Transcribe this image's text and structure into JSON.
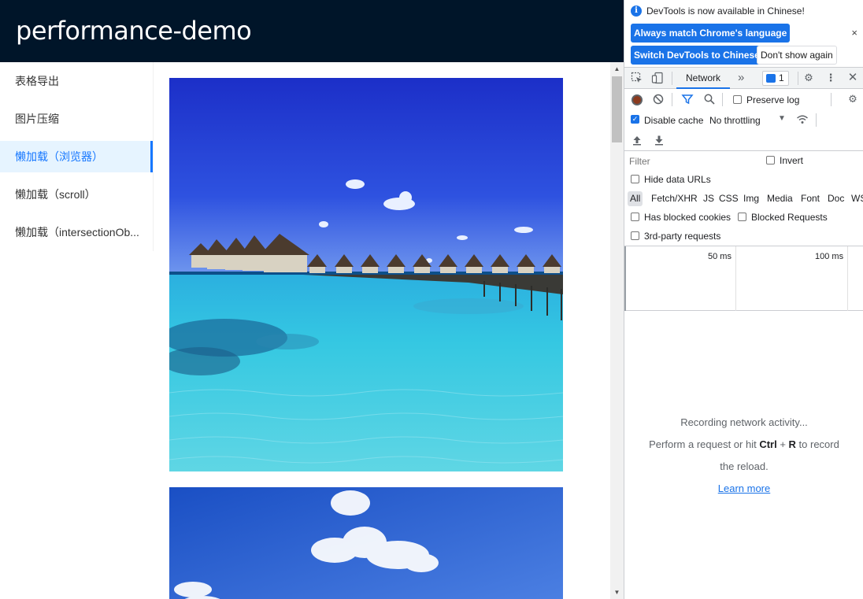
{
  "app": {
    "title": "performance-demo",
    "menu": [
      {
        "label": "表格导出"
      },
      {
        "label": "图片压缩"
      },
      {
        "label": "懒加载（浏览器）",
        "active": true
      },
      {
        "label": "懒加载（scroll）"
      },
      {
        "label": "懒加载（intersectionOb..."
      }
    ],
    "images": [
      {
        "icon": "overwater-villas-image"
      },
      {
        "icon": "sky-clouds-image"
      }
    ]
  },
  "devtools": {
    "infobar": {
      "message": "DevTools is now available in Chinese!",
      "match_language": "Always match Chrome's language",
      "switch_chinese": "Switch DevTools to Chinese",
      "dont_show": "Don't show again",
      "close": "×"
    },
    "tabs": {
      "network": "Network",
      "more": "»",
      "issues_count": "1"
    },
    "toolbar": {
      "preserve_log": "Preserve log",
      "disable_cache": "Disable cache",
      "throttling": "No throttling"
    },
    "filter": {
      "placeholder": "Filter",
      "invert": "Invert",
      "hide_data_urls": "Hide data URLs",
      "types": [
        "All",
        "Fetch/XHR",
        "JS",
        "CSS",
        "Img",
        "Media",
        "Font",
        "Doc",
        "WS"
      ],
      "has_blocked_cookies": "Has blocked cookies",
      "blocked_requests": "Blocked Requests",
      "third_party": "3rd-party requests"
    },
    "timeline": {
      "t1": "50 ms",
      "t2": "100 ms"
    },
    "empty": {
      "line1": "Recording network activity...",
      "line2_a": "Perform a request or hit ",
      "ctrl": "Ctrl",
      "plus": " + ",
      "r": "R",
      "line2_b": " to record",
      "line3": "the reload.",
      "learn_more": "Learn more"
    },
    "colors": {
      "accent": "#1a73e8",
      "header_bg": "#001529",
      "menu_active": "#1677ff"
    }
  }
}
